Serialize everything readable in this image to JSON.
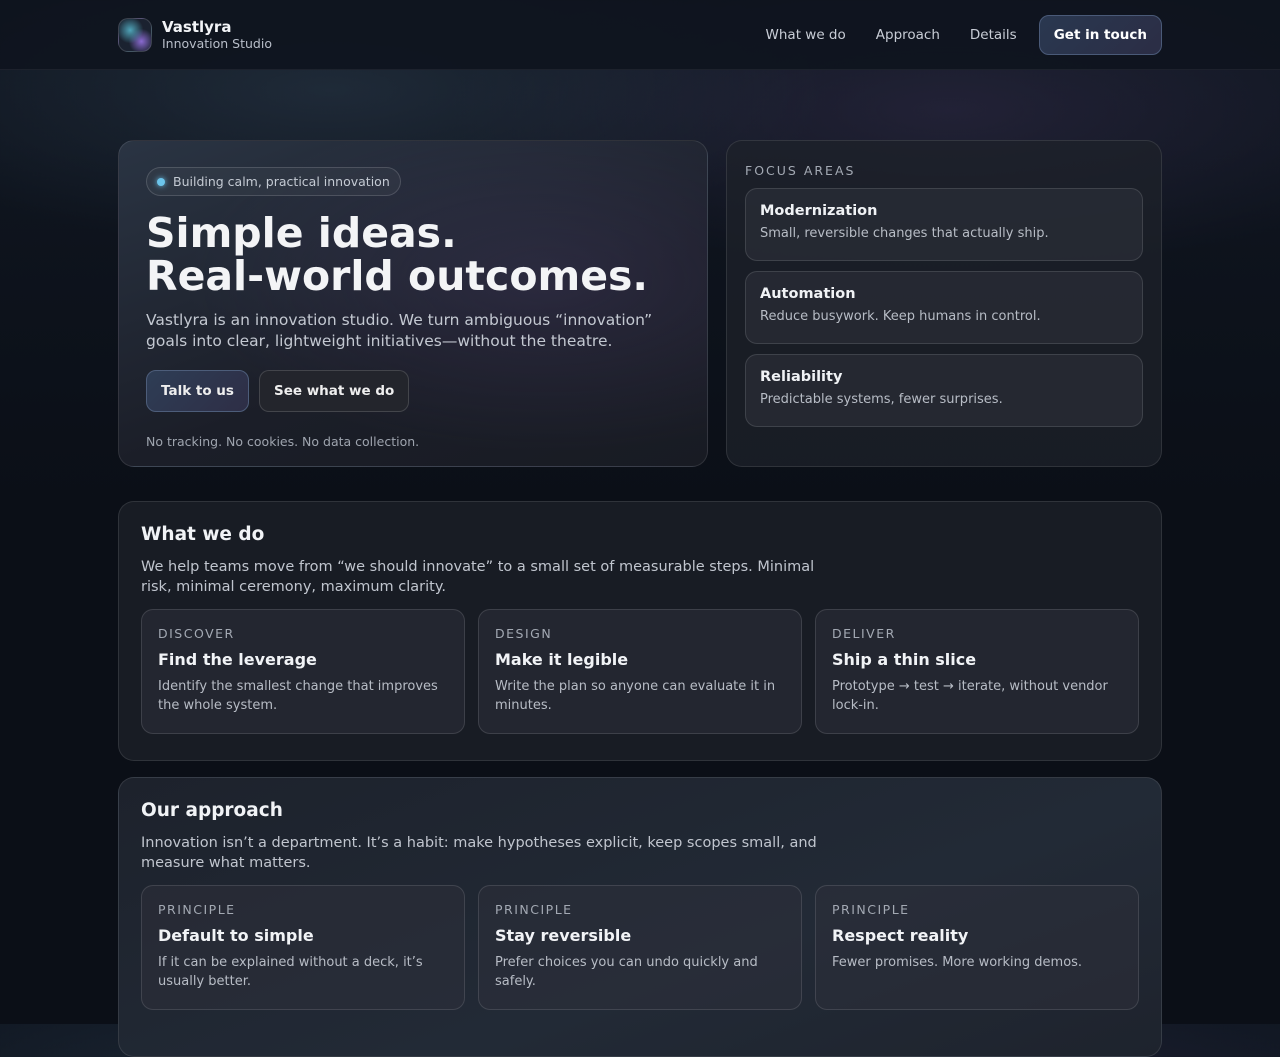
{
  "header": {
    "brand": "Vastlyra",
    "tagline": "Innovation Studio",
    "nav": [
      "What we do",
      "Approach",
      "Details"
    ],
    "cta": "Get in touch"
  },
  "hero": {
    "badge": "Building calm, practical innovation",
    "title1": "Simple ideas.",
    "title2": "Real-world outcomes.",
    "lead": "Vastlyra is an innovation studio. We turn ambiguous “innovation” goals into clear, lightweight initiatives—without the theatre.",
    "primary": "Talk to us",
    "secondary": "See what we do",
    "note": "No tracking. No cookies. No data collection."
  },
  "focus": {
    "label": "FOCUS AREAS",
    "items": [
      {
        "title": "Modernization",
        "desc": "Small, reversible changes that actually ship."
      },
      {
        "title": "Automation",
        "desc": "Reduce busywork. Keep humans in control."
      },
      {
        "title": "Reliability",
        "desc": "Predictable systems, fewer surprises."
      }
    ]
  },
  "what": {
    "title": "What we do",
    "text": "We help teams move from “we should innovate” to a small set of measurable steps. Minimal risk, minimal ceremony, maximum clarity.",
    "cards": [
      {
        "kicker": "DISCOVER",
        "title": "Find the leverage",
        "desc": "Identify the smallest change that improves the whole system."
      },
      {
        "kicker": "DESIGN",
        "title": "Make it legible",
        "desc": "Write the plan so anyone can evaluate it in minutes."
      },
      {
        "kicker": "DELIVER",
        "title": "Ship a thin slice",
        "desc": "Prototype → test → iterate, without vendor lock-in."
      }
    ]
  },
  "approach": {
    "title": "Our approach",
    "text": "Innovation isn’t a department. It’s a habit: make hypotheses explicit, keep scopes small, and measure what matters.",
    "cards": [
      {
        "kicker": "PRINCIPLE",
        "title": "Default to simple",
        "desc": "If it can be explained without a deck, it’s usually better."
      },
      {
        "kicker": "PRINCIPLE",
        "title": "Stay reversible",
        "desc": "Prefer choices you can undo quickly and safely."
      },
      {
        "kicker": "PRINCIPLE",
        "title": "Respect reality",
        "desc": "Fewer promises. More working demos."
      }
    ]
  }
}
